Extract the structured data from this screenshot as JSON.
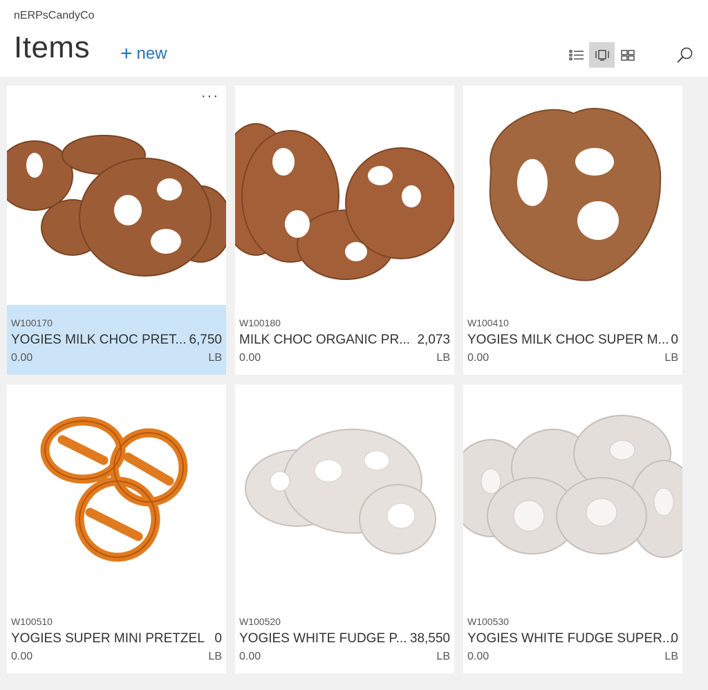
{
  "header": {
    "company": "nERPsCandyCo",
    "title": "Items",
    "new_label": "new",
    "icons": [
      "list-view-icon",
      "tile-view-icon",
      "grid-view-icon",
      "search-icon"
    ],
    "active_view": "tile-view"
  },
  "items": [
    {
      "code": "W100170",
      "name": "YOGIES MILK CHOC PRET...",
      "qty": "6,750",
      "price": "0.00",
      "unit": "LB",
      "selected": true,
      "kind": "milk-pretzels"
    },
    {
      "code": "W100180",
      "name": "MILK CHOC ORGANIC PR...",
      "qty": "2,073",
      "price": "0.00",
      "unit": "LB",
      "selected": false,
      "kind": "milk-pretzels"
    },
    {
      "code": "W100410",
      "name": "YOGIES MILK CHOC SUPER M...",
      "qty": "0",
      "price": "0.00",
      "unit": "LB",
      "selected": false,
      "kind": "single-milk-pretzel"
    },
    {
      "code": "W100510",
      "name": "YOGIES SUPER MINI PRETZEL",
      "qty": "0",
      "price": "0.00",
      "unit": "LB",
      "selected": false,
      "kind": "plain-pretzels"
    },
    {
      "code": "W100520",
      "name": "YOGIES WHITE FUDGE P...",
      "qty": "38,550",
      "price": "0.00",
      "unit": "LB",
      "selected": false,
      "kind": "white-pretzels"
    },
    {
      "code": "W100530",
      "name": "YOGIES WHITE FUDGE SUPER...",
      "qty": "0",
      "price": "0.00",
      "unit": "LB",
      "selected": false,
      "kind": "white-pretzels-pile"
    }
  ],
  "colors": {
    "accent": "#2a73b8",
    "selected_bg": "#cce4f7",
    "milk_choc": "#a0623a",
    "white_fudge": "#e8e4e0",
    "plain_pretzel": "#e07a1e"
  }
}
